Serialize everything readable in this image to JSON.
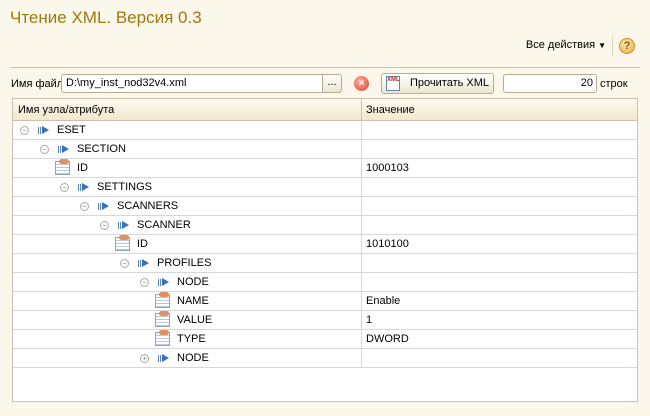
{
  "title": "Чтение XML. Версия 0.3",
  "toolbar": {
    "all_actions": "Все действия",
    "help": "?"
  },
  "form": {
    "file_label": "Имя файла:",
    "file_value": "D:\\my_inst_nod32v4.xml",
    "browse": "...",
    "clear": "×",
    "read_button": "Прочитать XML",
    "xml_icon_text": "XML",
    "rows_count": "20",
    "rows_label": "строк"
  },
  "tree": {
    "columns": [
      "Имя узла/атрибута",
      "Значение"
    ],
    "rows": [
      {
        "name": "ESET",
        "value": "",
        "level": 0,
        "type": "node",
        "expanded": true
      },
      {
        "name": "SECTION",
        "value": "",
        "level": 1,
        "type": "node",
        "expanded": true
      },
      {
        "name": "ID",
        "value": "1000103",
        "level": 2,
        "type": "attr"
      },
      {
        "name": "SETTINGS",
        "value": "",
        "level": 2,
        "type": "node",
        "expanded": true
      },
      {
        "name": "SCANNERS",
        "value": "",
        "level": 3,
        "type": "node",
        "expanded": true
      },
      {
        "name": "SCANNER",
        "value": "",
        "level": 4,
        "type": "node",
        "expanded": true
      },
      {
        "name": "ID",
        "value": "1010100",
        "level": 5,
        "type": "attr"
      },
      {
        "name": "PROFILES",
        "value": "",
        "level": 5,
        "type": "node",
        "expanded": true
      },
      {
        "name": "NODE",
        "value": "",
        "level": 6,
        "type": "node",
        "expanded": true
      },
      {
        "name": "NAME",
        "value": "Enable",
        "level": 7,
        "type": "attr"
      },
      {
        "name": "VALUE",
        "value": "1",
        "level": 7,
        "type": "attr"
      },
      {
        "name": "TYPE",
        "value": "DWORD",
        "level": 7,
        "type": "attr"
      },
      {
        "name": "NODE",
        "value": "",
        "level": 6,
        "type": "node",
        "expanded": false
      }
    ]
  }
}
